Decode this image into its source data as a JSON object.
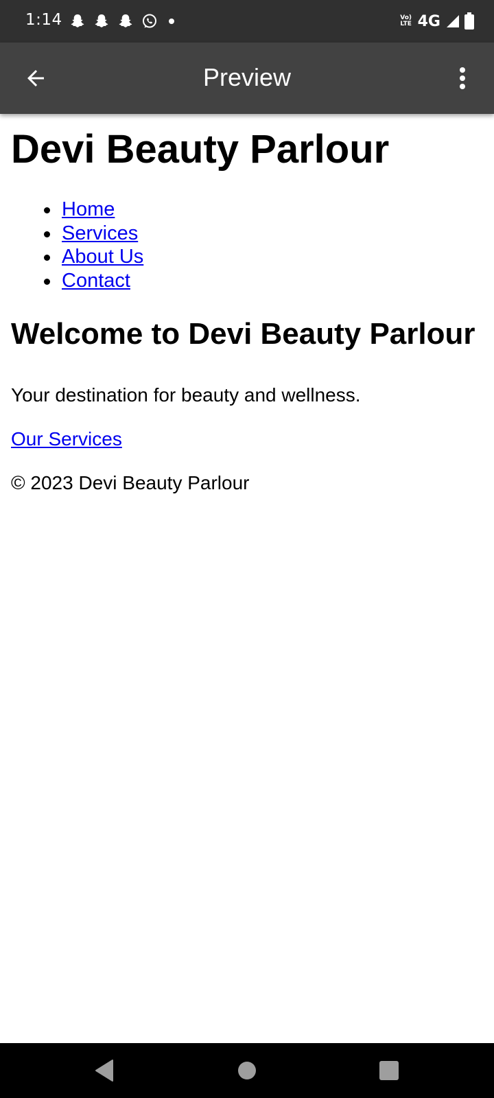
{
  "status_bar": {
    "time": "1:14",
    "network_type": "4G",
    "volte_line1": "Vo)",
    "volte_line2": "LTE",
    "notification_icons": [
      "snapchat-icon",
      "snapchat-icon",
      "snapchat-icon",
      "whatsapp-icon",
      "dot-icon"
    ],
    "right_icons": [
      "volte-icon",
      "signal-icon",
      "battery-icon"
    ]
  },
  "app_bar": {
    "title": "Preview",
    "back_icon": "arrow-left-icon",
    "menu_icon": "more-vert-icon"
  },
  "page": {
    "site_title": "Devi Beauty Parlour",
    "nav": [
      {
        "label": "Home"
      },
      {
        "label": "Services"
      },
      {
        "label": "About Us"
      },
      {
        "label": "Contact"
      }
    ],
    "welcome_heading": "Welcome to Devi Beauty Parlour",
    "tagline": "Your destination for beauty and wellness.",
    "services_link": "Our Services",
    "footer": "© 2023 Devi Beauty Parlour"
  },
  "colors": {
    "status_bar_bg": "#303030",
    "app_bar_bg": "#424242",
    "link": "#0000ee",
    "nav_bar_bg": "#000000"
  },
  "system_nav": [
    "back-triangle-icon",
    "home-circle-icon",
    "recents-square-icon"
  ]
}
